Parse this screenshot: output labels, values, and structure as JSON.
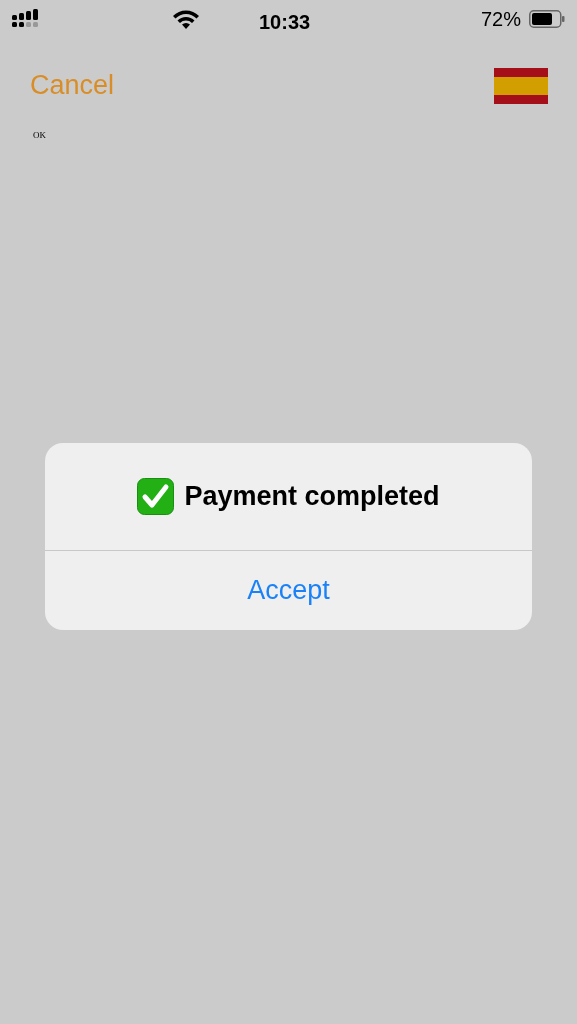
{
  "status_bar": {
    "time": "10:33",
    "battery": "72%"
  },
  "nav": {
    "cancel": "Cancel"
  },
  "label": "OK",
  "alert": {
    "title": "Payment completed",
    "button": "Accept"
  }
}
